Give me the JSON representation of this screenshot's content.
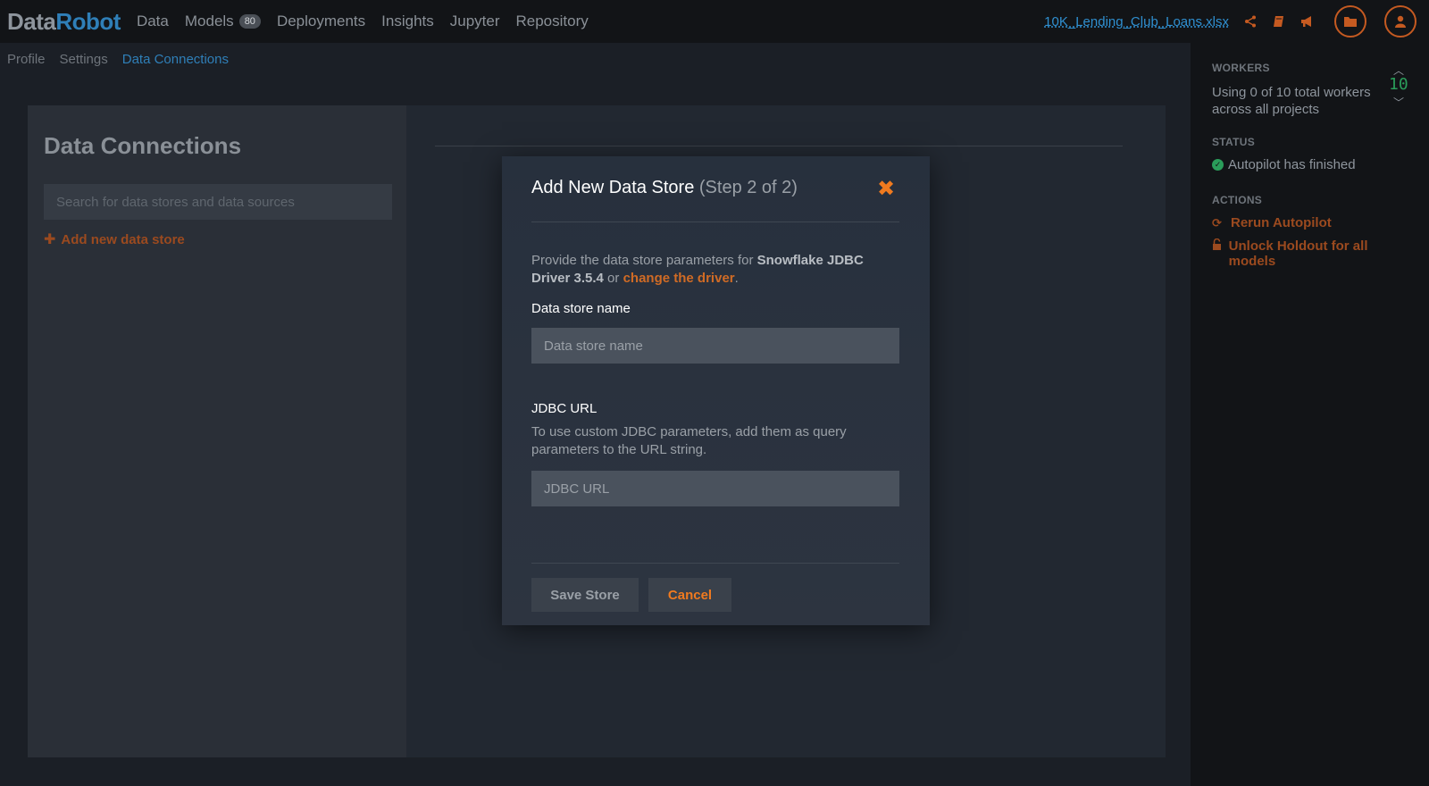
{
  "header": {
    "logo_part1": "Data",
    "logo_part2": "Robot",
    "nav": [
      {
        "label": "Data"
      },
      {
        "label": "Models",
        "badge": "80"
      },
      {
        "label": "Deployments"
      },
      {
        "label": "Insights"
      },
      {
        "label": "Jupyter"
      },
      {
        "label": "Repository"
      }
    ],
    "project_file": "10K_Lending_Club_Loans.xlsx",
    "icons": [
      "share-icon",
      "book-icon",
      "megaphone-icon",
      "folder-icon",
      "user-icon"
    ]
  },
  "subnav": {
    "items": [
      "Profile",
      "Settings",
      "Data Connections"
    ],
    "active": "Data Connections"
  },
  "left_panel": {
    "title": "Data Connections",
    "search_placeholder": "Search for data stores and data sources",
    "add_label": "Add new data store"
  },
  "modal": {
    "title": "Add New Data Store",
    "step": "(Step 2 of 2)",
    "desc_prefix": "Provide the data store parameters for ",
    "driver_name": "Snowflake JDBC Driver 3.5.4",
    "desc_or": " or ",
    "change_link": "change the driver",
    "desc_end": ".",
    "name_label": "Data store name",
    "name_placeholder": "Data store name",
    "jdbc_label": "JDBC URL",
    "jdbc_help": "To use custom JDBC parameters, add them as query parameters to the URL string.",
    "jdbc_placeholder": "JDBC URL",
    "save_label": "Save Store",
    "cancel_label": "Cancel"
  },
  "sidebar": {
    "workers_heading": "WORKERS",
    "workers_text": "Using 0 of 10 total workers across all projects",
    "workers_count": "10",
    "status_heading": "STATUS",
    "status_text": "Autopilot has finished",
    "actions_heading": "ACTIONS",
    "actions": [
      {
        "label": "Rerun Autopilot",
        "icon": "refresh-icon"
      },
      {
        "label": "Unlock Holdout for all models",
        "icon": "unlock-icon"
      }
    ]
  },
  "colors": {
    "accent_orange": "#f07a1f",
    "brand_blue": "#2f7fb8",
    "status_green": "#2a9d5a"
  }
}
